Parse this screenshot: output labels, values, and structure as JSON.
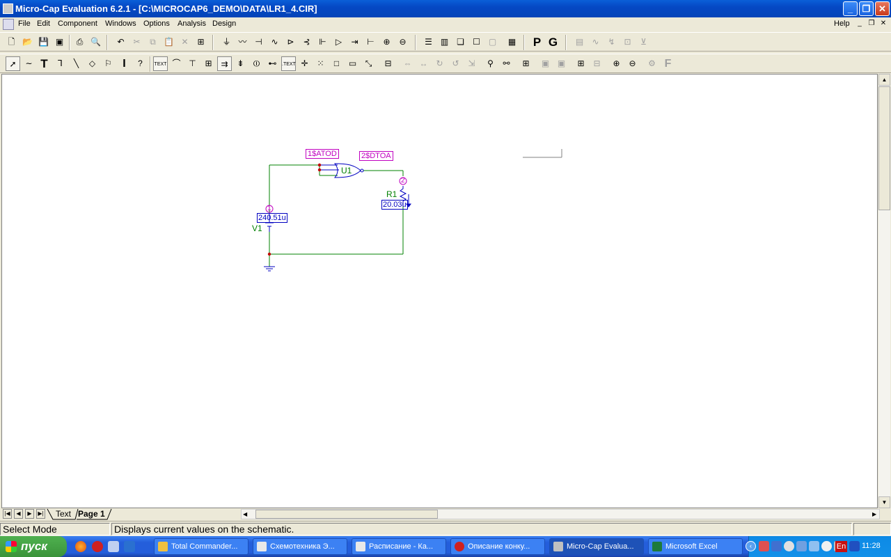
{
  "window": {
    "title": "Micro-Cap Evaluation 6.2.1 - [C:\\MICROCAP6_DEMO\\DATA\\LR1_4.CIR]",
    "min_label": "_",
    "restore_label": "❐",
    "close_label": "✕"
  },
  "menu": {
    "items": [
      "File",
      "Edit",
      "Component",
      "Windows",
      "Options",
      "Analysis",
      "Design"
    ],
    "help": "Help"
  },
  "toolbar1": {
    "p_label": "P",
    "g_label": "G"
  },
  "toolbar2": {
    "text_label": "T",
    "info_label": "I",
    "f_label": "F"
  },
  "schematic": {
    "gate_name": "U1",
    "gate_input_label": "1$ATOD",
    "gate_output_label": "2$DTOA",
    "resistor_name": "R1",
    "resistor_value": "20.03u",
    "resistor_node": "2",
    "source_name": "V1",
    "source_value": "240.51u",
    "source_node": "1"
  },
  "tabs": {
    "text": "Text",
    "page1": "Page 1"
  },
  "status": {
    "mode": "Select Mode",
    "message": "Displays current values on the schematic."
  },
  "taskbar": {
    "start": "пуск",
    "tasks": [
      {
        "label": "Total Commander...",
        "active": false,
        "color": "#f0c040"
      },
      {
        "label": "Схемотехника Э...",
        "active": false,
        "color": "#e8e8e8"
      },
      {
        "label": "Расписание - Ка...",
        "active": false,
        "color": "#e8e8e8"
      },
      {
        "label": "Описание конку...",
        "active": false,
        "color": "#d02020"
      },
      {
        "label": "Micro-Cap Evalua...",
        "active": true,
        "color": "#c0c0c0"
      },
      {
        "label": "Microsoft Excel",
        "active": false,
        "color": "#1d7a3a"
      }
    ],
    "lang": "En",
    "clock": "11:28"
  }
}
